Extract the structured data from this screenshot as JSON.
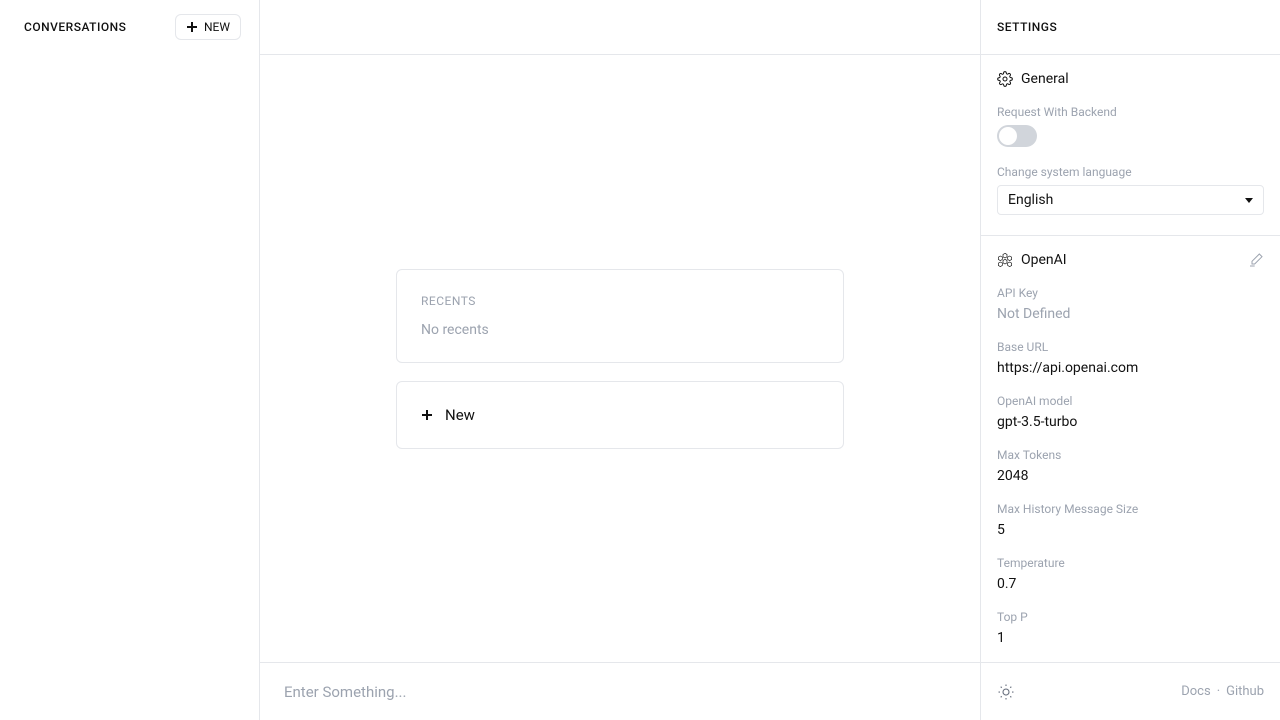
{
  "left": {
    "title": "CONVERSATIONS",
    "new_btn": "NEW"
  },
  "main": {
    "recents_label": "RECENTS",
    "recents_empty": "No recents",
    "new_label": "New",
    "input_placeholder": "Enter Something..."
  },
  "settings": {
    "header": "SETTINGS",
    "general": {
      "title": "General",
      "request_backend_label": "Request With Backend",
      "language_label": "Change system language",
      "language_value": "English"
    },
    "openai": {
      "title": "OpenAI",
      "api_key_label": "API Key",
      "api_key_value": "Not Defined",
      "base_url_label": "Base URL",
      "base_url_value": "https://api.openai.com",
      "model_label": "OpenAI model",
      "model_value": "gpt-3.5-turbo",
      "max_tokens_label": "Max Tokens",
      "max_tokens_value": "2048",
      "max_history_label": "Max History Message Size",
      "max_history_value": "5",
      "temperature_label": "Temperature",
      "temperature_value": "0.7",
      "top_p_label": "Top P",
      "top_p_value": "1"
    }
  },
  "footer": {
    "docs": "Docs",
    "github": "Github"
  }
}
